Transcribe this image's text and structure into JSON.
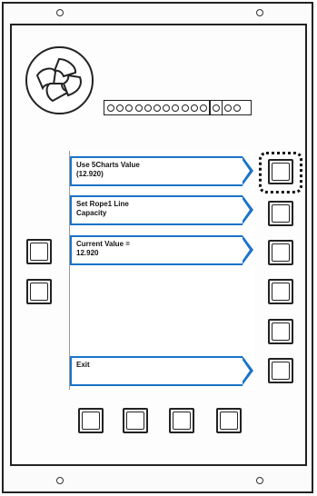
{
  "softkeys": [
    {
      "line1": "Use 5Charts Value",
      "line2": "(12.920)"
    },
    {
      "line1": "Set Rope1 Line",
      "line2": "Capacity"
    },
    {
      "line1": "Current Value =",
      "line2": "12.920"
    },
    {
      "line1": "Exit",
      "line2": ""
    }
  ],
  "focused_button": "right-button-1",
  "colors": {
    "softkey_border": "#1a73c8",
    "panel_stroke": "#222222"
  },
  "icons": [
    "fan-icon",
    "connector-pins-icon"
  ]
}
